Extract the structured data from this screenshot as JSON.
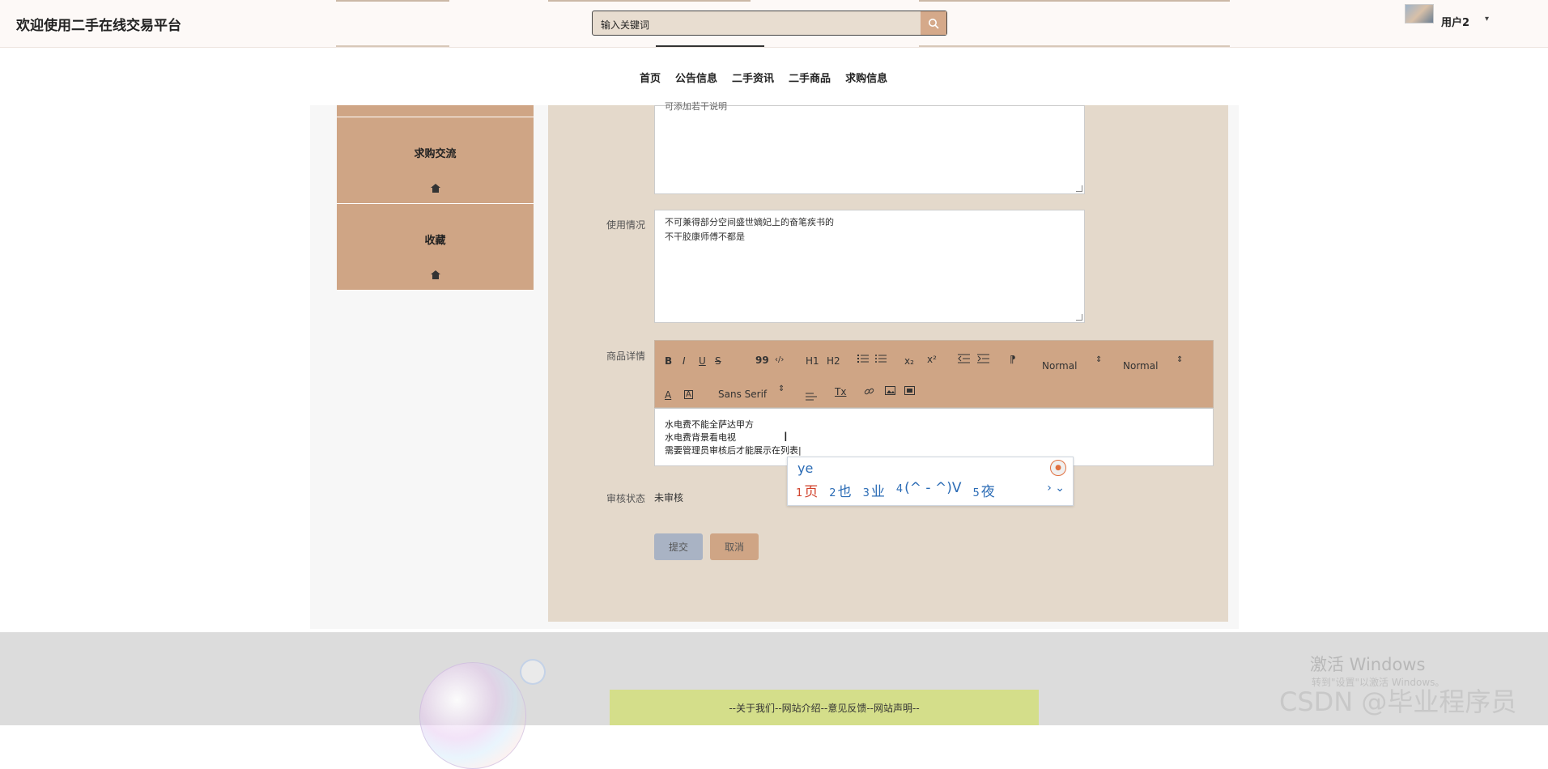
{
  "header": {
    "site_title": "欢迎使用二手在线交易平台",
    "search_placeholder": "输入关键词",
    "user_name": "用户2",
    "user_caret": "▾"
  },
  "nav": {
    "items": [
      "首页",
      "公告信息",
      "二手资讯",
      "二手商品",
      "求购信息"
    ]
  },
  "sidebar": {
    "items": [
      {
        "label": "求购交流",
        "icon": "home-icon"
      },
      {
        "label": "收藏",
        "icon": "home-icon"
      }
    ]
  },
  "form": {
    "cut_text": "可添加若干说明",
    "usage_label": "使用情况",
    "usage_text": [
      "不可兼得部分空间盛世嫡妃上的奋笔疾书的",
      "不干胶康师傅不都是"
    ],
    "details_label": "商品详情",
    "editor": {
      "toolbar": {
        "bold": "B",
        "italic": "I",
        "underline": "U",
        "strike": "S",
        "blockquote": "99",
        "code": "‹/›",
        "h1": "H1",
        "h2": "H2",
        "sub": "x₂",
        "sup": "x²",
        "rtl": "⁋",
        "size_select": "Normal",
        "header_select": "Normal",
        "font_select": "Sans Serif",
        "clean": "Tx"
      },
      "content": [
        "水电费不能全萨达甲方",
        "水电费背景看电视",
        "需要管理员审核后才能展示在列表|"
      ]
    },
    "status_label": "审核状态",
    "status_value": "未审核",
    "submit_label": "提交",
    "cancel_label": "取消"
  },
  "ime": {
    "input": "ye",
    "candidates": [
      {
        "n": "1",
        "text": "页"
      },
      {
        "n": "2",
        "text": "也"
      },
      {
        "n": "3",
        "text": "业"
      },
      {
        "n": "4",
        "text": "(^ - ^)V"
      },
      {
        "n": "5",
        "text": "夜"
      }
    ],
    "more": "› ⌄"
  },
  "footer": {
    "links": "--关于我们--网站介绍--意见反馈--网站声明--"
  },
  "overlay": {
    "activate_title": "激活 Windows",
    "activate_sub": "转到\"设置\"以激活 Windows。",
    "watermark": "CSDN @毕业程序员"
  }
}
